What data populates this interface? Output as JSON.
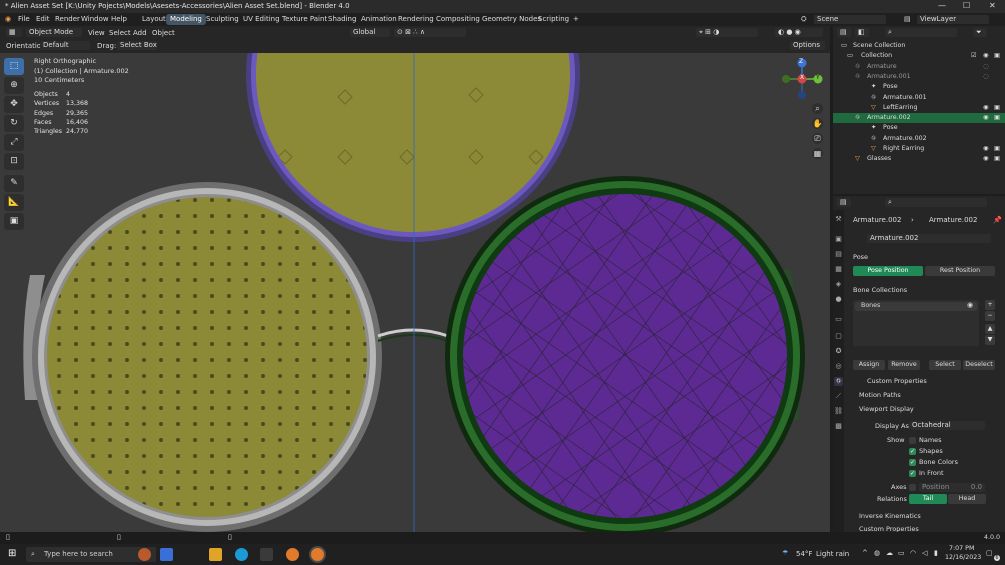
{
  "window": {
    "title": "* Alien Asset Set [K:\\Unity Pojects\\Models\\Asesets-Accessories\\Alien Asset Set.blend] - Blender 4.0",
    "minimize": "—",
    "maximize": "☐",
    "close": "✕"
  },
  "menu": {
    "items": [
      "File",
      "Edit",
      "Render",
      "Window",
      "Help"
    ],
    "workspaces": [
      "Layout",
      "Modeling",
      "Sculpting",
      "UV Editing",
      "Texture Paint",
      "Shading",
      "Animation",
      "Rendering",
      "Compositing",
      "Geometry Nodes",
      "Scripting"
    ],
    "active_workspace": "Modeling",
    "add_tab": "+",
    "scene_label": "Scene",
    "viewlayer_label": "ViewLayer"
  },
  "vp_header": {
    "mode": "Object Mode",
    "menus": [
      "View",
      "Select",
      "Add",
      "Object"
    ],
    "transform": "Global",
    "options": "Options",
    "orientation_label": "Orientation:",
    "orientation_value": "Default",
    "drag_label": "Drag:",
    "drag_value": "Select Box"
  },
  "viewport": {
    "view_name": "Right Orthographic",
    "collection_line": "(1) Collection | Armature.002",
    "scale_line": "10 Centimeters",
    "stats": [
      {
        "label": "Objects",
        "value": "4"
      },
      {
        "label": "Vertices",
        "value": "13,368"
      },
      {
        "label": "Edges",
        "value": "29,365"
      },
      {
        "label": "Faces",
        "value": "16,406"
      },
      {
        "label": "Triangles",
        "value": "24,770"
      }
    ],
    "gizmo": {
      "z": "Z",
      "y": "Y",
      "x": "X"
    }
  },
  "outliner": {
    "rows": [
      {
        "label": "Scene Collection",
        "indent": 0,
        "selected": false
      },
      {
        "label": "Collection",
        "indent": 1,
        "selected": false
      },
      {
        "label": "Armature",
        "indent": 2,
        "selected": false
      },
      {
        "label": "Armature.001",
        "indent": 2,
        "selected": false
      },
      {
        "label": "Pose",
        "indent": 3,
        "selected": false
      },
      {
        "label": "Armature.001",
        "indent": 3,
        "selected": false
      },
      {
        "label": "LeftEarring",
        "indent": 3,
        "selected": false
      },
      {
        "label": "Armature.002",
        "indent": 2,
        "selected": true
      },
      {
        "label": "Pose",
        "indent": 3,
        "selected": false
      },
      {
        "label": "Armature.002",
        "indent": 3,
        "selected": false
      },
      {
        "label": "Right Earring",
        "indent": 3,
        "selected": false
      },
      {
        "label": "Glasses",
        "indent": 2,
        "selected": false
      }
    ]
  },
  "properties": {
    "breadcrumb_obj": "Armature.002",
    "breadcrumb_data": "Armature.002",
    "data_name": "Armature.002",
    "pose_header": "Pose",
    "pose_position": "Pose Position",
    "rest_position": "Rest Position",
    "bone_collections_header": "Bone Collections",
    "bones_item": "Bones",
    "assign": "Assign",
    "remove": "Remove",
    "select": "Select",
    "deselect": "Deselect",
    "custom_properties_sub": "Custom Properties",
    "motion_paths": "Motion Paths",
    "viewport_display": "Viewport Display",
    "display_as_label": "Display As",
    "display_as_value": "Octahedral",
    "show_label": "Show",
    "names": "Names",
    "shapes": "Shapes",
    "bone_colors": "Bone Colors",
    "in_front": "In Front",
    "axes_label": "Axes",
    "position_label": "Position",
    "position_value": "0.0",
    "relations_label": "Relations",
    "tail": "Tail",
    "head": "Head",
    "inverse_kinematics": "Inverse Kinematics",
    "custom_properties": "Custom Properties"
  },
  "status": {
    "version": "4.0.0"
  },
  "taskbar": {
    "search_placeholder": "Type here to search",
    "weather_temp": "54°F",
    "weather_desc": "Light rain",
    "time": "7:07 PM",
    "date": "12/16/2023",
    "notification_count": "6"
  },
  "colors": {
    "lens_yellow": "#8d8a37",
    "lens_purple": "#5d2a93",
    "frame_silver": "#b7b7b7",
    "frame_green": "#1f5a1f",
    "frame_purple": "#5a3aa8",
    "accent_active": "#3d6fa8",
    "selection_green": "#1f8a55"
  }
}
